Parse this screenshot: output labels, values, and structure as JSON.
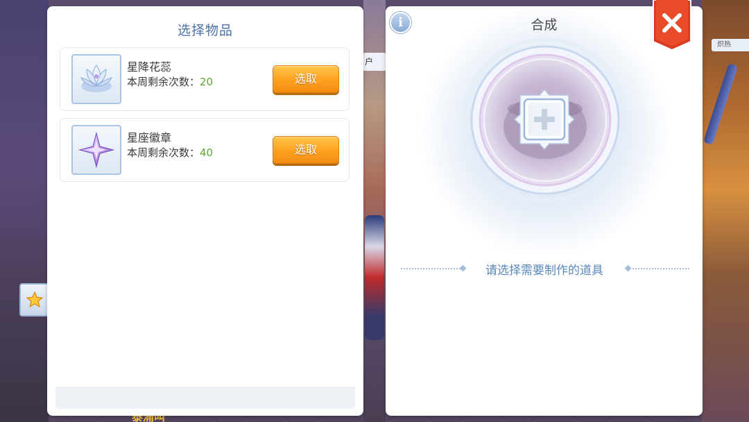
{
  "left_panel": {
    "title": "选择物品",
    "items": [
      {
        "name": "星降花蕊",
        "remain_label": "本周剩余次数：",
        "remain_count": "20",
        "select_label": "选取",
        "icon": "lotus-icon"
      },
      {
        "name": "星座徽章",
        "remain_label": "本周剩余次数：",
        "remain_count": "40",
        "select_label": "选取",
        "icon": "star-badge-icon"
      }
    ]
  },
  "right_panel": {
    "title": "合成",
    "info_label": "i",
    "hint": "请选择需要制作的道具",
    "slot_icon": "plus-icon",
    "close_icon": "close-icon"
  },
  "scene": {
    "fav_icon": "star-icon",
    "mid_tag": "户",
    "right_tag": "炽热",
    "bottom_text": "泰涌叫"
  },
  "colors": {
    "accent_blue": "#4a72a8",
    "count_green": "#5aa832",
    "button_orange": "#ffa020",
    "close_red": "#d83a22"
  }
}
